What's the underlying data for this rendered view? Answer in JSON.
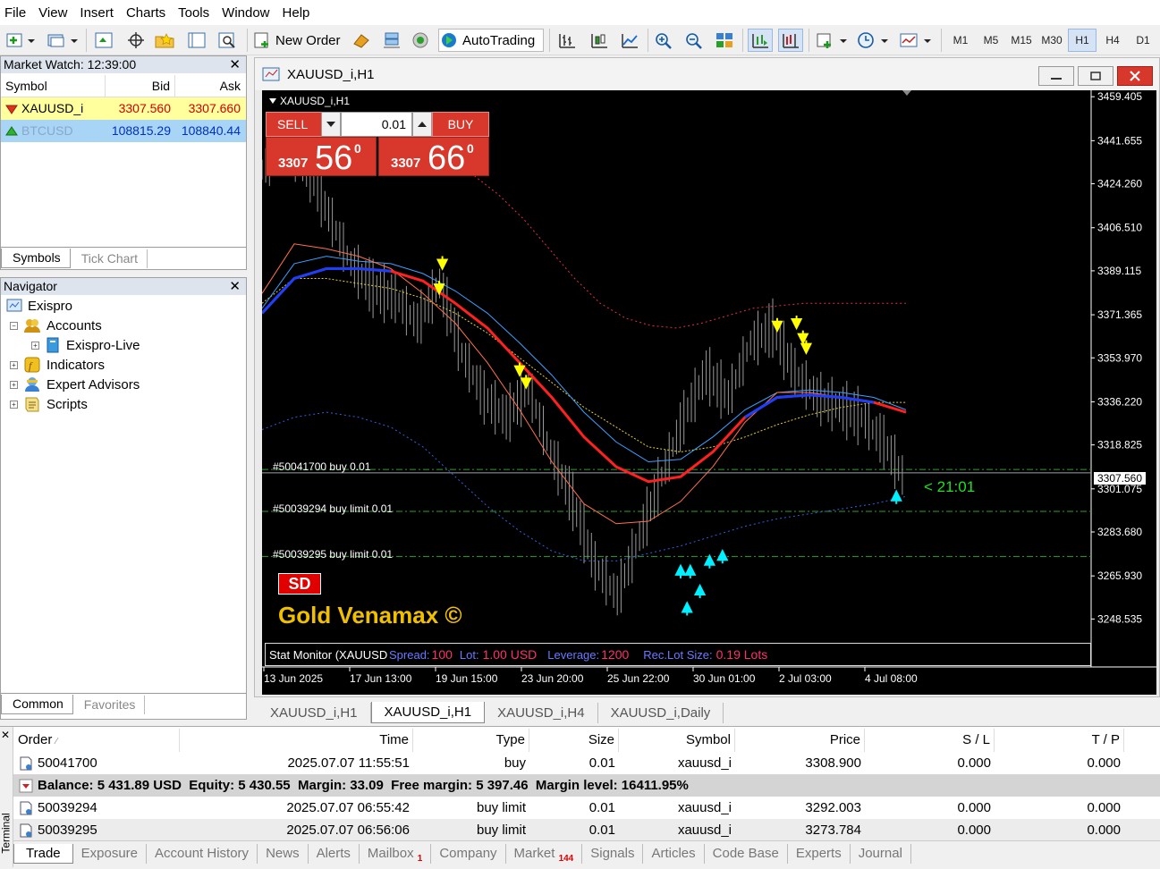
{
  "menu": [
    "File",
    "View",
    "Insert",
    "Charts",
    "Tools",
    "Window",
    "Help"
  ],
  "toolbar": {
    "new_order": "New Order",
    "autotrading": "AutoTrading",
    "timeframes": [
      "M1",
      "M5",
      "M15",
      "M30",
      "H1",
      "H4",
      "D1"
    ],
    "active_timeframe": "H1"
  },
  "market_watch": {
    "title": "Market Watch: 12:39:00",
    "headers": {
      "symbol": "Symbol",
      "bid": "Bid",
      "ask": "Ask"
    },
    "rows": [
      {
        "symbol": "XAUUSD_i",
        "bid": "3307.560",
        "ask": "3307.660"
      },
      {
        "symbol": "BTCUSD",
        "bid": "108815.29",
        "ask": "108840.44"
      }
    ],
    "tabs": [
      "Symbols",
      "Tick Chart"
    ]
  },
  "navigator": {
    "title": "Navigator",
    "items": [
      "Exispro",
      "Accounts",
      "Exispro-Live",
      "Indicators",
      "Expert Advisors",
      "Scripts"
    ],
    "tabs": [
      "Common",
      "Favorites"
    ]
  },
  "chart_window": {
    "title": "XAUUSD_i,H1",
    "label": "XAUUSD_i,H1",
    "trade_panel": {
      "sell": "SELL",
      "buy": "BUY",
      "lot": "0.01",
      "sell_prefix": "3307",
      "sell_big": "56",
      "sell_sup": "0",
      "buy_prefix": "3307",
      "buy_big": "66",
      "buy_sup": "0"
    },
    "order_lines": [
      {
        "label": "#50041700 buy 0.01",
        "price": 3308.9
      },
      {
        "label": "#50039294 buy limit 0.01",
        "price": 3292.003
      },
      {
        "label": "#50039295 buy limit 0.01",
        "price": 3273.784
      }
    ],
    "bid_line": 3307.56,
    "bid_label": "3307.560",
    "timer": "< 21:01",
    "sd_badge": "SD",
    "watermark": "Gold Venamax ©",
    "stat_monitor": {
      "prefix": "Stat Monitor (XAUUSD_i)",
      "spread_label": "Spread:",
      "spread": "100",
      "lot_label": "Lot:",
      "lot": "1.00 USD",
      "lev_label": "Leverage:",
      "lev": "1200",
      "rec_label": "Rec.Lot Size:",
      "rec": "0.19 Lots"
    }
  },
  "chart_data": {
    "type": "line",
    "y_axis_ticks": [
      "3459.405",
      "3441.655",
      "3424.260",
      "3406.510",
      "3389.115",
      "3371.365",
      "3353.970",
      "3336.220",
      "3318.825",
      "3301.075",
      "3283.680",
      "3265.930",
      "3248.535"
    ],
    "x_axis_ticks": [
      "13 Jun 2025",
      "17 Jun 13:00",
      "19 Jun 15:00",
      "23 Jun 20:00",
      "25 Jun 22:00",
      "30 Jun 01:00",
      "2 Jul 03:00",
      "4 Jul 08:00"
    ],
    "ylim": [
      3240,
      3462
    ],
    "series": [
      {
        "values": [
          3372,
          3386,
          3390,
          3390,
          3389,
          3385,
          3376,
          3366,
          3352,
          3338,
          3322,
          3310,
          3304,
          3306,
          3316,
          3330,
          3338,
          3339,
          3338,
          3336,
          3332
        ]
      },
      {
        "values": [
          3374,
          3392,
          3395,
          3393,
          3392,
          3388,
          3381,
          3372,
          3360,
          3347,
          3332,
          3320,
          3312,
          3313,
          3322,
          3333,
          3340,
          3341,
          3340,
          3338,
          3333
        ]
      },
      {
        "values": [
          3380,
          3400,
          3398,
          3395,
          3390,
          3380,
          3368,
          3352,
          3333,
          3312,
          3295,
          3287,
          3288,
          3296,
          3310,
          3328,
          3340,
          3340,
          3338,
          3336,
          3332
        ]
      },
      {
        "values": [
          3376,
          3386,
          3386,
          3384,
          3382,
          3378,
          3372,
          3364,
          3354,
          3344,
          3334,
          3326,
          3318,
          3316,
          3318,
          3322,
          3327,
          3331,
          3334,
          3336,
          3336
        ]
      },
      {
        "values": [
          3440,
          3438,
          3434,
          3428,
          3420,
          3410,
          3398,
          3386,
          3376,
          3370,
          3367,
          3366,
          3368,
          3371,
          3374,
          3375,
          3376,
          3376,
          3376,
          3376,
          3376
        ]
      },
      {
        "values": [
          3325,
          3330,
          3332,
          3330,
          3326,
          3318,
          3306,
          3294,
          3284,
          3276,
          3272,
          3272,
          3275,
          3278,
          3282,
          3286,
          3289,
          3291,
          3293,
          3295,
          3298
        ]
      },
      {
        "values": [
          3430,
          3440,
          3432,
          3412,
          3392,
          3382,
          3378,
          3368,
          3384,
          3356,
          3338,
          3330,
          3342,
          3316,
          3296,
          3270,
          3258,
          3282,
          3306,
          3330,
          3348,
          3338,
          3360,
          3366,
          3348,
          3338,
          3334,
          3330,
          3320,
          3304
        ]
      }
    ],
    "arrows_down": [
      [
        0.28,
        3390
      ],
      [
        0.275,
        3380
      ],
      [
        0.4,
        3347
      ],
      [
        0.41,
        3342
      ],
      [
        0.8,
        3365
      ],
      [
        0.83,
        3366
      ],
      [
        0.84,
        3360
      ],
      [
        0.845,
        3356
      ]
    ],
    "arrows_up": [
      [
        0.65,
        3270
      ],
      [
        0.665,
        3270
      ],
      [
        0.68,
        3262
      ],
      [
        0.695,
        3274
      ],
      [
        0.715,
        3276
      ],
      [
        0.66,
        3255
      ],
      [
        0.985,
        3300
      ]
    ]
  },
  "chart_tabs": [
    "XAUUSD_i,H1",
    "XAUUSD_i,H1",
    "XAUUSD_i,H4",
    "XAUUSD_i,Daily"
  ],
  "chart_tab_active": 1,
  "terminal": {
    "headers": {
      "order": "Order",
      "time": "Time",
      "type": "Type",
      "size": "Size",
      "symbol": "Symbol",
      "price": "Price",
      "sl": "S / L",
      "tp": "T / P"
    },
    "rows": [
      {
        "order": "50041700",
        "time": "2025.07.07 11:55:51",
        "type": "buy",
        "size": "0.01",
        "symbol": "xauusd_i",
        "price": "3308.900",
        "sl": "0.000",
        "tp": "0.000"
      },
      {
        "order": "50039294",
        "time": "2025.07.07 06:55:42",
        "type": "buy limit",
        "size": "0.01",
        "symbol": "xauusd_i",
        "price": "3292.003",
        "sl": "0.000",
        "tp": "0.000"
      },
      {
        "order": "50039295",
        "time": "2025.07.07 06:56:06",
        "type": "buy limit",
        "size": "0.01",
        "symbol": "xauusd_i",
        "price": "3273.784",
        "sl": "0.000",
        "tp": "0.000"
      }
    ],
    "balance_line": "Balance: 5 431.89 USD  Equity: 5 430.55  Margin: 33.09  Free margin: 5 397.46  Margin level: 16411.95%",
    "side_label": "Terminal",
    "tabs": [
      "Trade",
      "Exposure",
      "Account History",
      "News",
      "Alerts",
      "Mailbox",
      "Company",
      "Market",
      "Signals",
      "Articles",
      "Code Base",
      "Experts",
      "Journal"
    ],
    "mailbox_badge": "1",
    "market_badge": "144"
  }
}
